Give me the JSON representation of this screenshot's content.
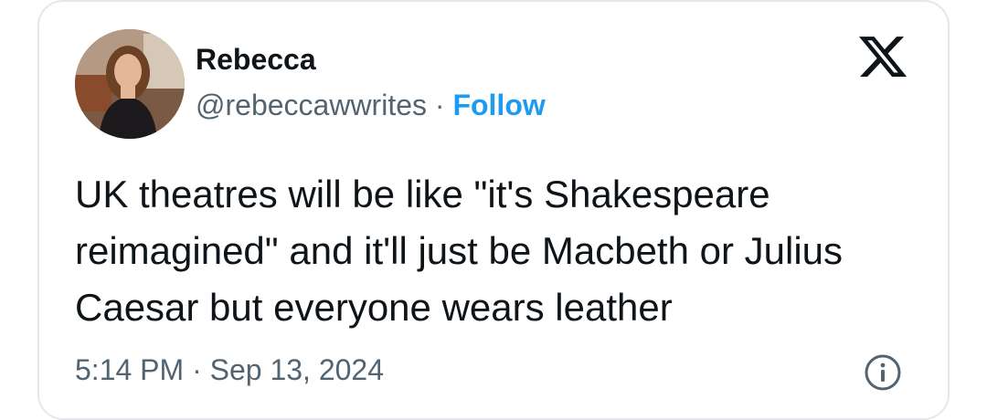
{
  "author": {
    "name": "Rebecca",
    "handle": "@rebeccawwrites",
    "separator": " · ",
    "follow_label": "Follow"
  },
  "tweet": {
    "text": "UK theatres will be like \"it's Shakespeare reimagined\" and it'll just be Macbeth or Julius Caesar but everyone wears leather",
    "time": "5:14 PM",
    "separator": " · ",
    "date": "Sep 13, 2024"
  },
  "icons": {
    "brand": "x-logo-icon",
    "info": "info-icon"
  },
  "colors": {
    "text": "#0f1419",
    "secondary": "#536471",
    "follow": "#1d9bf0",
    "border": "#e4e8ec"
  }
}
